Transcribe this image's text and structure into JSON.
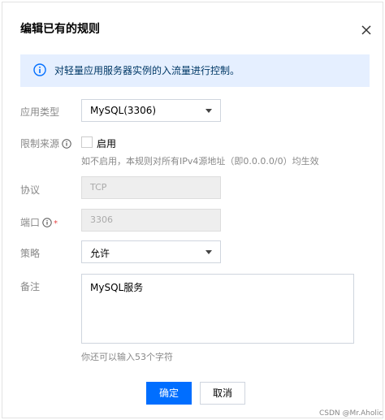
{
  "dialog": {
    "title": "编辑已有的规则",
    "close_icon": "close-icon"
  },
  "notice": {
    "icon": "info-icon",
    "text": "对轻量应用服务器实例的入流量进行控制。"
  },
  "form": {
    "app_type": {
      "label": "应用类型",
      "value": "MySQL(3306)"
    },
    "source_limit": {
      "label": "限制来源",
      "help_icon": "help-icon",
      "checkbox_label": "启用",
      "checked": false,
      "hint": "如不启用，本规则对所有IPv4源地址（即0.0.0.0/0）均生效"
    },
    "protocol": {
      "label": "协议",
      "value": "TCP"
    },
    "port": {
      "label": "端口",
      "required_mark": "*",
      "help_icon": "help-icon",
      "value": "3306"
    },
    "policy": {
      "label": "策略",
      "value": "允许"
    },
    "remark": {
      "label": "备注",
      "value": "MySQL服务",
      "hint": "你还可以输入53个字符"
    }
  },
  "buttons": {
    "confirm": "确定",
    "cancel": "取消"
  },
  "watermark": "CSDN @Mr.Aholic",
  "colors": {
    "primary": "#006eff",
    "notice_bg": "#e5efff",
    "required": "#e54545"
  }
}
